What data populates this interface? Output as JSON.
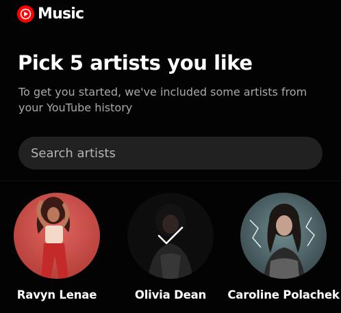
{
  "app": {
    "name": "Music"
  },
  "header": {
    "title": "Pick 5 artists you like"
  },
  "intro": {
    "subtitle": "To get you started, we've included some artists from your YouTube history"
  },
  "search": {
    "placeholder": "Search artists",
    "value": ""
  },
  "artists": [
    {
      "name": "Ravyn Lenae",
      "selected": false
    },
    {
      "name": "Olivia Dean",
      "selected": true
    },
    {
      "name": "Caroline Polachek",
      "selected": false
    }
  ],
  "colors": {
    "background": "#030303",
    "brand": "#ff0000",
    "search_bg": "#212121",
    "subtitle": "#aaaaaa"
  }
}
